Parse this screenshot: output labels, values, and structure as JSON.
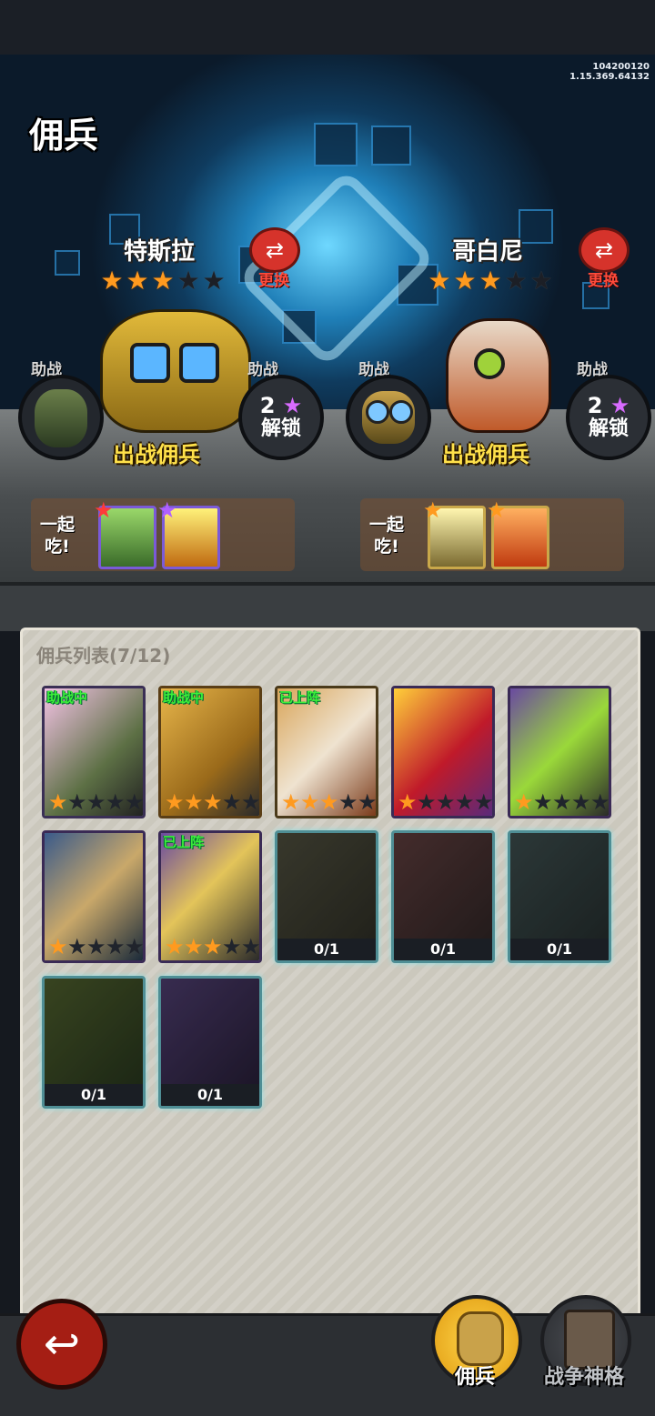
{
  "version": {
    "line1": "104200120",
    "line2": "1.15.369.64132"
  },
  "page_title": "佣兵",
  "heroes": [
    {
      "name": "特斯拉",
      "stars": 3,
      "max_stars": 5,
      "swap_label": "更换",
      "deploy_label": "出战佣兵",
      "assist_label": "助战",
      "lock_label": "助战",
      "lock_count": "2",
      "lock_text": "解锁",
      "eat_label_1": "一起",
      "eat_label_2": "吃!"
    },
    {
      "name": "哥白尼",
      "stars": 3,
      "max_stars": 5,
      "swap_label": "更换",
      "deploy_label": "出战佣兵",
      "assist_label": "助战",
      "lock_label": "助战",
      "lock_count": "2",
      "lock_text": "解锁",
      "eat_label_1": "一起",
      "eat_label_2": "吃!"
    }
  ],
  "list": {
    "title": "佣兵列表(7/12)",
    "cards": [
      {
        "tag": "助战中",
        "stars": 1,
        "progress": ""
      },
      {
        "tag": "助战中",
        "stars": 3,
        "progress": ""
      },
      {
        "tag": "已上阵",
        "stars": 3,
        "progress": ""
      },
      {
        "tag": "",
        "stars": 1,
        "progress": ""
      },
      {
        "tag": "",
        "stars": 1,
        "progress": ""
      },
      {
        "tag": "",
        "stars": 1,
        "progress": ""
      },
      {
        "tag": "已上阵",
        "stars": 3,
        "progress": ""
      },
      {
        "tag": "",
        "stars": 0,
        "progress": "0/1"
      },
      {
        "tag": "",
        "stars": 0,
        "progress": "0/1"
      },
      {
        "tag": "",
        "stars": 0,
        "progress": "0/1"
      },
      {
        "tag": "",
        "stars": 0,
        "progress": "0/1"
      },
      {
        "tag": "",
        "stars": 0,
        "progress": "0/1"
      }
    ]
  },
  "bottom_nav": {
    "back_icon": "back-arrow-icon",
    "mercenary_label": "佣兵",
    "war_label": "战争神格"
  },
  "colors": {
    "star_on": "#ff9a1f",
    "tag_green": "#3cf03a",
    "back_red": "#a51e14",
    "active_nav": "#f2b81c"
  }
}
